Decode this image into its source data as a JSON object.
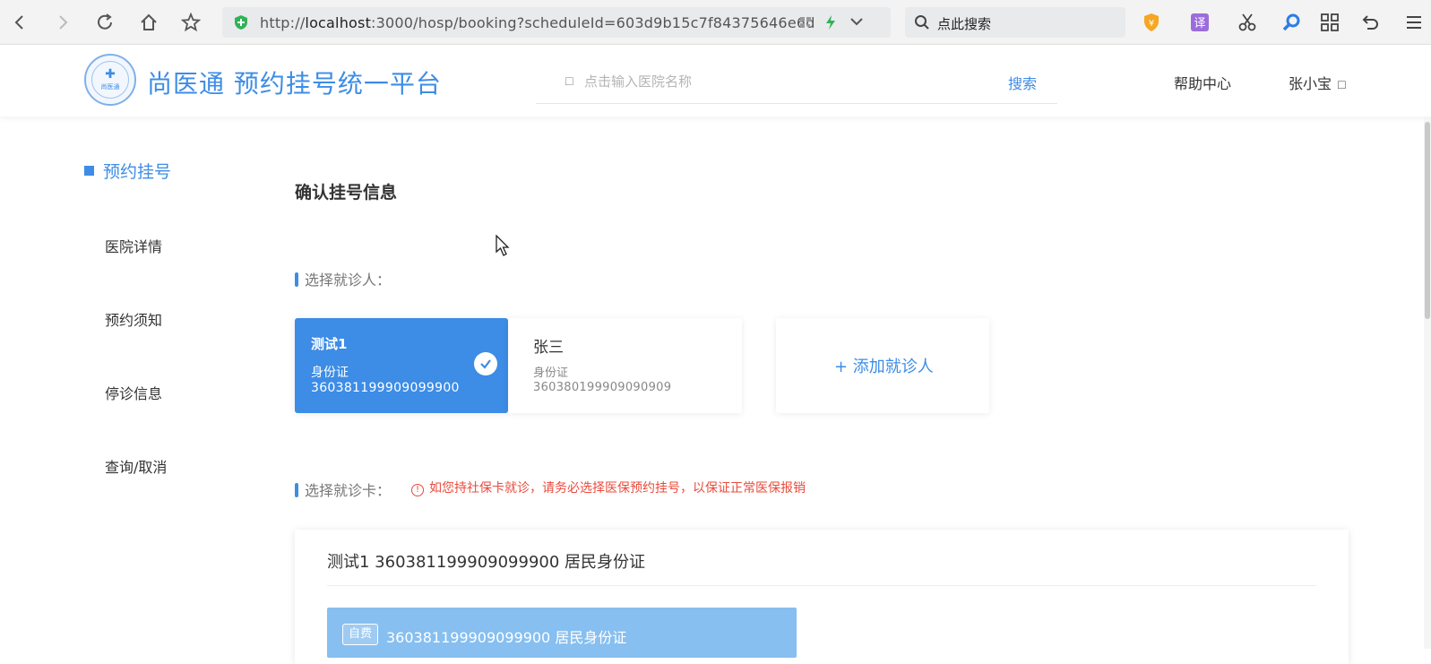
{
  "browser": {
    "url_prefix": "http://",
    "url_host": "localhost",
    "url_rest": ":3000/hosp/booking?scheduleId=603d9b15c7f84375646e6d",
    "search_text": "点此搜索"
  },
  "header": {
    "logo_text": "尚医通",
    "site_title": "尚医通 预约挂号统一平台",
    "search_placeholder": "点击输入医院名称",
    "search_button": "搜索",
    "help_link": "帮助中心",
    "user_name": "张小宝"
  },
  "sidebar": {
    "items": [
      {
        "label": "预约挂号"
      },
      {
        "label": "医院详情"
      },
      {
        "label": "预约须知"
      },
      {
        "label": "停诊信息"
      },
      {
        "label": "查询/取消"
      }
    ]
  },
  "main": {
    "title": "确认挂号信息",
    "patient_section_label": "选择就诊人：",
    "patients": [
      {
        "name": "测试1",
        "id_type": "身份证",
        "id_number": "360381199909099900"
      },
      {
        "name": "张三",
        "id_type": "身份证",
        "id_number": "360380199909090909"
      }
    ],
    "add_patient_label": "+ 添加就诊人",
    "card_section_label": "选择就诊卡：",
    "card_warning": "如您持社保卡就诊，请务必选择医保预约挂号，以保证正常医保报销",
    "card_panel_title": "测试1 360381199909099900 居民身份证",
    "card_chip": {
      "tag": "自费",
      "text": "360381199909099900  居民身份证"
    }
  },
  "colors": {
    "primary": "#3d8ce6",
    "warning": "#e94b3c",
    "chip": "#87bff0"
  }
}
